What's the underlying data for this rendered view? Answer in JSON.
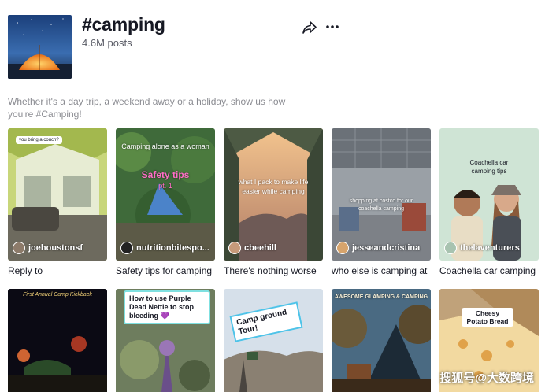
{
  "header": {
    "title": "#camping",
    "post_count": "4.6M posts",
    "description": "Whether it's a day trip, a weekend away or a holiday, show us how you're #Camping!",
    "share_icon": "share-arrow-icon",
    "more_icon": "ellipsis-icon"
  },
  "videos": [
    {
      "author": "joehoustonsf",
      "caption": "Reply to",
      "overlay": "you bring a couch?"
    },
    {
      "author": "nutritionbitespo...",
      "caption": "Safety tips for camping",
      "overlay": "Camping alone as a woman",
      "overlay2": "Safety tips",
      "overlay3": "pt. 1"
    },
    {
      "author": "cbeehill",
      "caption": "There's nothing worse",
      "overlay": "what I pack to make life easier while camping"
    },
    {
      "author": "jesseandcristina",
      "caption": "who else is camping at",
      "overlay": "shopping at costco for our coachella camping"
    },
    {
      "author": "thelaventurers",
      "caption": "Coachella car camping",
      "overlay": "Coachella car camping tips"
    },
    {
      "author": "",
      "caption": "",
      "overlay": "First Annual Camp Kickback"
    },
    {
      "author": "",
      "caption": "",
      "overlay": "How to use Purple Dead Nettle to stop bleeding 💜"
    },
    {
      "author": "",
      "caption": "",
      "overlay": "Camp ground Tour!"
    },
    {
      "author": "",
      "caption": "",
      "overlay": "AWESOME GLAMPING & CAMPING"
    },
    {
      "author": "",
      "caption": "",
      "overlay": "Cheesy Potato Bread"
    }
  ],
  "watermark": "搜狐号@大数跨境",
  "colors": {
    "text": "#161823",
    "muted": "#8a8b91"
  }
}
